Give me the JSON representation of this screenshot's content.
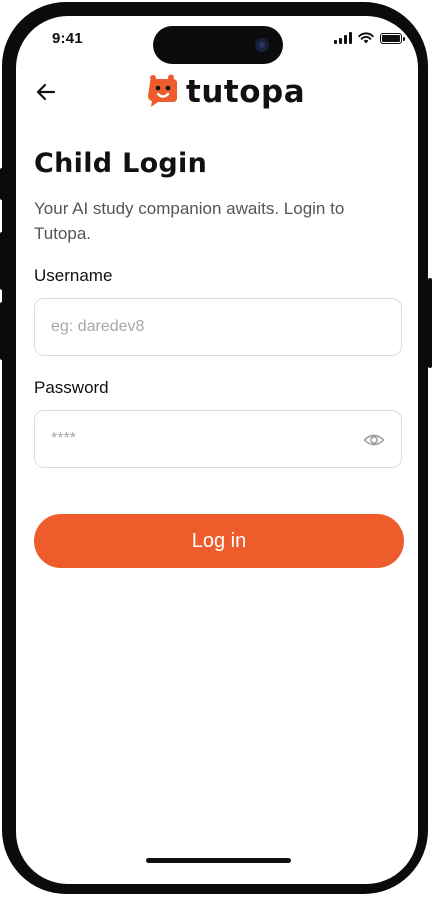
{
  "status_bar": {
    "time": "9:41"
  },
  "header": {
    "brand_name": "tutopa",
    "brand_color": "#ee5c2c",
    "back_icon": "arrow-left-icon",
    "logo_icon": "chat-bubble-mascot-icon"
  },
  "main": {
    "title": "Child Login",
    "subtitle": "Your AI study companion awaits. Login to Tutopa."
  },
  "form": {
    "username_label": "Username",
    "username_placeholder": "eg: daredev8",
    "username_value": "",
    "password_label": "Password",
    "password_placeholder": "****",
    "password_value": "",
    "password_toggle_icon": "eye-icon",
    "submit_label": "Log in",
    "submit_color": "#ee5c2c"
  }
}
